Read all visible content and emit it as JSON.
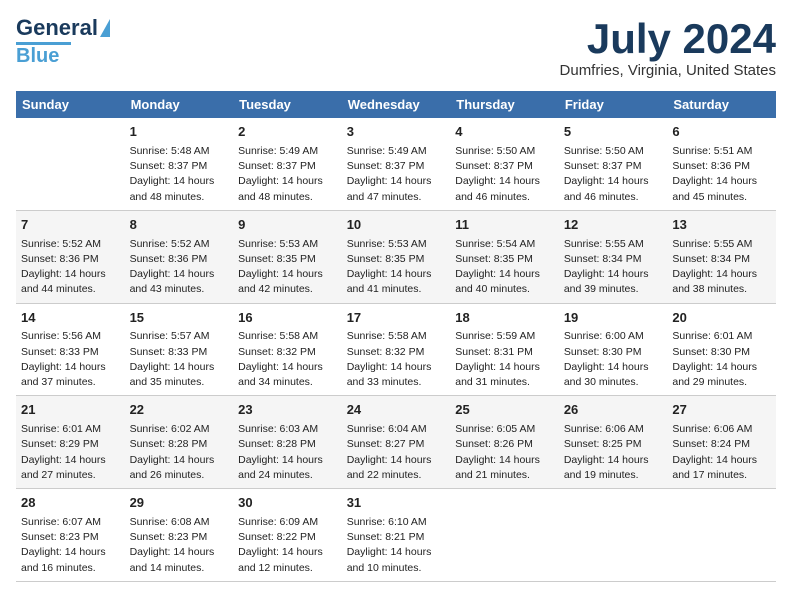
{
  "logo": {
    "line1": "General",
    "line2": "Blue"
  },
  "title": "July 2024",
  "location": "Dumfries, Virginia, United States",
  "days_header": [
    "Sunday",
    "Monday",
    "Tuesday",
    "Wednesday",
    "Thursday",
    "Friday",
    "Saturday"
  ],
  "weeks": [
    [
      {
        "day": "",
        "info": ""
      },
      {
        "day": "1",
        "info": "Sunrise: 5:48 AM\nSunset: 8:37 PM\nDaylight: 14 hours\nand 48 minutes."
      },
      {
        "day": "2",
        "info": "Sunrise: 5:49 AM\nSunset: 8:37 PM\nDaylight: 14 hours\nand 48 minutes."
      },
      {
        "day": "3",
        "info": "Sunrise: 5:49 AM\nSunset: 8:37 PM\nDaylight: 14 hours\nand 47 minutes."
      },
      {
        "day": "4",
        "info": "Sunrise: 5:50 AM\nSunset: 8:37 PM\nDaylight: 14 hours\nand 46 minutes."
      },
      {
        "day": "5",
        "info": "Sunrise: 5:50 AM\nSunset: 8:37 PM\nDaylight: 14 hours\nand 46 minutes."
      },
      {
        "day": "6",
        "info": "Sunrise: 5:51 AM\nSunset: 8:36 PM\nDaylight: 14 hours\nand 45 minutes."
      }
    ],
    [
      {
        "day": "7",
        "info": "Sunrise: 5:52 AM\nSunset: 8:36 PM\nDaylight: 14 hours\nand 44 minutes."
      },
      {
        "day": "8",
        "info": "Sunrise: 5:52 AM\nSunset: 8:36 PM\nDaylight: 14 hours\nand 43 minutes."
      },
      {
        "day": "9",
        "info": "Sunrise: 5:53 AM\nSunset: 8:35 PM\nDaylight: 14 hours\nand 42 minutes."
      },
      {
        "day": "10",
        "info": "Sunrise: 5:53 AM\nSunset: 8:35 PM\nDaylight: 14 hours\nand 41 minutes."
      },
      {
        "day": "11",
        "info": "Sunrise: 5:54 AM\nSunset: 8:35 PM\nDaylight: 14 hours\nand 40 minutes."
      },
      {
        "day": "12",
        "info": "Sunrise: 5:55 AM\nSunset: 8:34 PM\nDaylight: 14 hours\nand 39 minutes."
      },
      {
        "day": "13",
        "info": "Sunrise: 5:55 AM\nSunset: 8:34 PM\nDaylight: 14 hours\nand 38 minutes."
      }
    ],
    [
      {
        "day": "14",
        "info": "Sunrise: 5:56 AM\nSunset: 8:33 PM\nDaylight: 14 hours\nand 37 minutes."
      },
      {
        "day": "15",
        "info": "Sunrise: 5:57 AM\nSunset: 8:33 PM\nDaylight: 14 hours\nand 35 minutes."
      },
      {
        "day": "16",
        "info": "Sunrise: 5:58 AM\nSunset: 8:32 PM\nDaylight: 14 hours\nand 34 minutes."
      },
      {
        "day": "17",
        "info": "Sunrise: 5:58 AM\nSunset: 8:32 PM\nDaylight: 14 hours\nand 33 minutes."
      },
      {
        "day": "18",
        "info": "Sunrise: 5:59 AM\nSunset: 8:31 PM\nDaylight: 14 hours\nand 31 minutes."
      },
      {
        "day": "19",
        "info": "Sunrise: 6:00 AM\nSunset: 8:30 PM\nDaylight: 14 hours\nand 30 minutes."
      },
      {
        "day": "20",
        "info": "Sunrise: 6:01 AM\nSunset: 8:30 PM\nDaylight: 14 hours\nand 29 minutes."
      }
    ],
    [
      {
        "day": "21",
        "info": "Sunrise: 6:01 AM\nSunset: 8:29 PM\nDaylight: 14 hours\nand 27 minutes."
      },
      {
        "day": "22",
        "info": "Sunrise: 6:02 AM\nSunset: 8:28 PM\nDaylight: 14 hours\nand 26 minutes."
      },
      {
        "day": "23",
        "info": "Sunrise: 6:03 AM\nSunset: 8:28 PM\nDaylight: 14 hours\nand 24 minutes."
      },
      {
        "day": "24",
        "info": "Sunrise: 6:04 AM\nSunset: 8:27 PM\nDaylight: 14 hours\nand 22 minutes."
      },
      {
        "day": "25",
        "info": "Sunrise: 6:05 AM\nSunset: 8:26 PM\nDaylight: 14 hours\nand 21 minutes."
      },
      {
        "day": "26",
        "info": "Sunrise: 6:06 AM\nSunset: 8:25 PM\nDaylight: 14 hours\nand 19 minutes."
      },
      {
        "day": "27",
        "info": "Sunrise: 6:06 AM\nSunset: 8:24 PM\nDaylight: 14 hours\nand 17 minutes."
      }
    ],
    [
      {
        "day": "28",
        "info": "Sunrise: 6:07 AM\nSunset: 8:23 PM\nDaylight: 14 hours\nand 16 minutes."
      },
      {
        "day": "29",
        "info": "Sunrise: 6:08 AM\nSunset: 8:23 PM\nDaylight: 14 hours\nand 14 minutes."
      },
      {
        "day": "30",
        "info": "Sunrise: 6:09 AM\nSunset: 8:22 PM\nDaylight: 14 hours\nand 12 minutes."
      },
      {
        "day": "31",
        "info": "Sunrise: 6:10 AM\nSunset: 8:21 PM\nDaylight: 14 hours\nand 10 minutes."
      },
      {
        "day": "",
        "info": ""
      },
      {
        "day": "",
        "info": ""
      },
      {
        "day": "",
        "info": ""
      }
    ]
  ]
}
